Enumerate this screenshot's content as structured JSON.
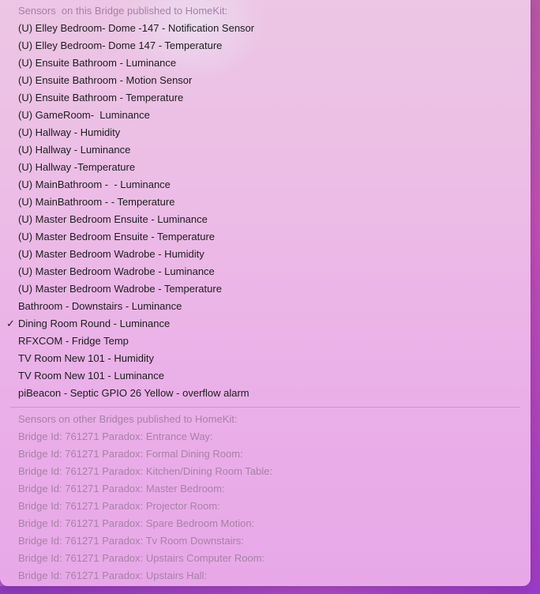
{
  "bridge_sensors": {
    "header": "Sensors  on this Bridge published to HomeKit:",
    "items": [
      {
        "label": "(U) Elley Bedroom- Dome -147 - Notification Sensor",
        "checked": false
      },
      {
        "label": "(U) Elley Bedroom- Dome 147 - Temperature",
        "checked": false
      },
      {
        "label": "(U) Ensuite Bathroom - Luminance",
        "checked": false
      },
      {
        "label": "(U) Ensuite Bathroom - Motion Sensor",
        "checked": false
      },
      {
        "label": "(U) Ensuite Bathroom - Temperature",
        "checked": false
      },
      {
        "label": "(U) GameRoom-  Luminance",
        "checked": false
      },
      {
        "label": "(U) Hallway - Humidity",
        "checked": false
      },
      {
        "label": "(U) Hallway - Luminance",
        "checked": false
      },
      {
        "label": "(U) Hallway -Temperature",
        "checked": false
      },
      {
        "label": "(U) MainBathroom -  - Luminance",
        "checked": false
      },
      {
        "label": "(U) MainBathroom - - Temperature",
        "checked": false
      },
      {
        "label": "(U) Master Bedroom Ensuite - Luminance",
        "checked": false
      },
      {
        "label": "(U) Master Bedroom Ensuite - Temperature",
        "checked": false
      },
      {
        "label": "(U) Master Bedroom Wadrobe - Humidity",
        "checked": false
      },
      {
        "label": "(U) Master Bedroom Wadrobe - Luminance",
        "checked": false
      },
      {
        "label": "(U) Master Bedroom Wadrobe - Temperature",
        "checked": false
      },
      {
        "label": "Bathroom - Downstairs - Luminance",
        "checked": false
      },
      {
        "label": "Dining Room Round - Luminance",
        "checked": true
      },
      {
        "label": "RFXCOM - Fridge Temp",
        "checked": false
      },
      {
        "label": "TV Room New 101 - Humidity",
        "checked": false
      },
      {
        "label": "TV Room New 101 - Luminance",
        "checked": false
      },
      {
        "label": "piBeacon - Septic GPIO 26 Yellow - overflow alarm",
        "checked": false
      }
    ]
  },
  "checkmark_glyph": "✓",
  "other_bridges": {
    "header": "Sensors on other Bridges published to HomeKit:",
    "items": [
      "Bridge Id: 761271 Paradox: Entrance Way:",
      "Bridge Id: 761271 Paradox: Formal Dining Room:",
      "Bridge Id: 761271 Paradox: Kitchen/Dining Room Table:",
      "Bridge Id: 761271 Paradox: Master Bedroom:",
      "Bridge Id: 761271 Paradox: Projector Room:",
      "Bridge Id: 761271 Paradox: Spare Bedroom Motion:",
      "Bridge Id: 761271 Paradox: Tv Room Downstairs:",
      "Bridge Id: 761271 Paradox: Upstairs Computer Room:",
      "Bridge Id: 761271 Paradox: Upstairs Hall:"
    ]
  },
  "colors": {
    "text": "#1d1d1f",
    "disabled_text": "#a781a6",
    "menu_background": "#ecbce6",
    "desktop": "#b04cc8"
  }
}
